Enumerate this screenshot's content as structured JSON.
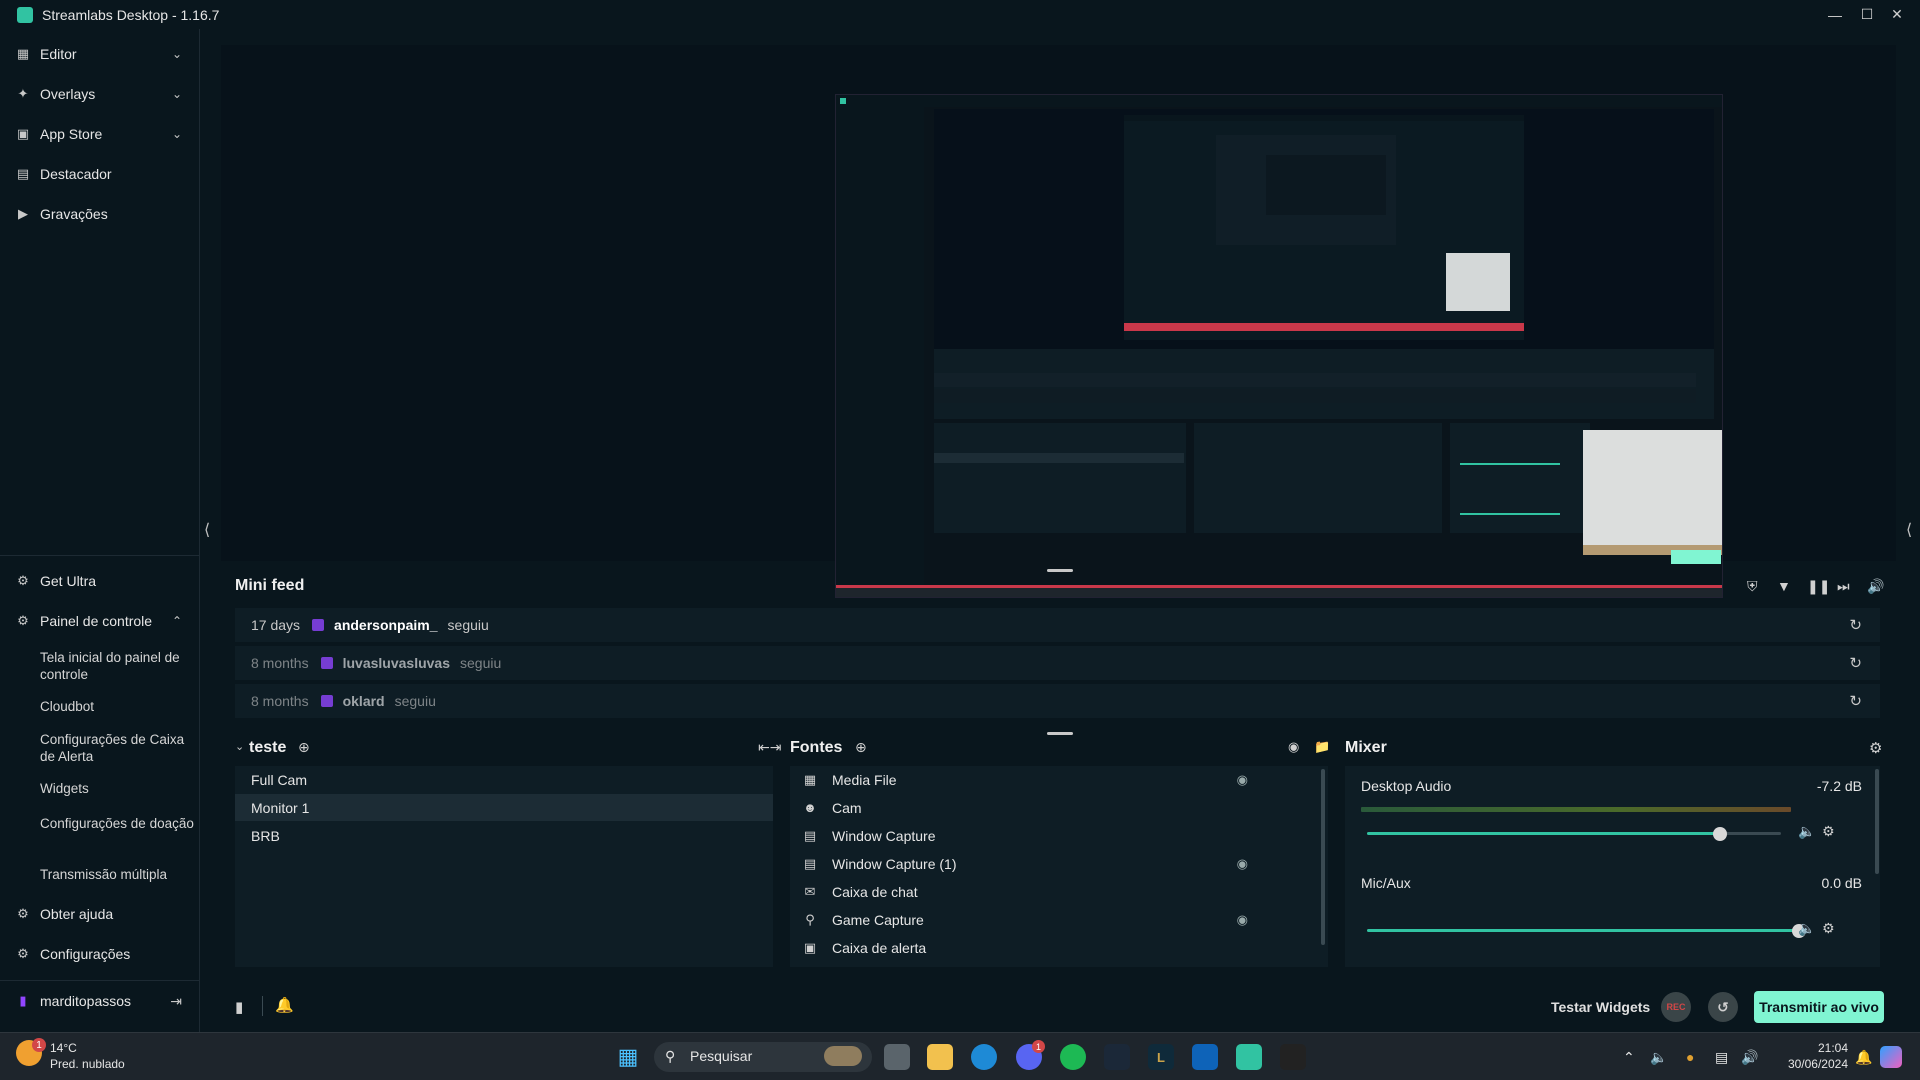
{
  "window": {
    "title": "Streamlabs Desktop - 1.16.7"
  },
  "sidebar": {
    "top_items": [
      {
        "label": "Editor",
        "icon": "editor-icon"
      },
      {
        "label": "Overlays",
        "icon": "overlays-icon"
      },
      {
        "label": "App Store",
        "icon": "app-store-icon"
      },
      {
        "label": "Destacador",
        "icon": "highlighter-icon"
      },
      {
        "label": "Gravações",
        "icon": "recordings-icon"
      }
    ],
    "get_ultra": "Get Ultra",
    "dashboard": "Painel de controle",
    "dashboard_sub": [
      "Tela inicial do painel de controle",
      "Cloudbot",
      "Configurações de Caixa de Alerta",
      "Widgets",
      "Configurações de doação",
      "Transmissão múltipla"
    ],
    "help": "Obter ajuda",
    "settings": "Configurações",
    "account": "marditopassos"
  },
  "minifeed": {
    "title": "Mini feed",
    "rows": [
      {
        "time": "17 days",
        "user": "andersonpaim_",
        "action": "seguiu"
      },
      {
        "time": "8 months",
        "user": "luvasluvasluvas",
        "action": "seguiu"
      },
      {
        "time": "8 months",
        "user": "oklard",
        "action": "seguiu"
      }
    ]
  },
  "scenes": {
    "title": "teste",
    "items": [
      "Full Cam",
      "Monitor 1",
      "BRB"
    ],
    "selected": "Monitor 1"
  },
  "sources": {
    "title": "Fontes",
    "items": [
      {
        "label": "Media File",
        "icon": "media-file-icon",
        "hidden": true
      },
      {
        "label": "Cam",
        "icon": "camera-icon",
        "hidden": false
      },
      {
        "label": "Window Capture",
        "icon": "window-icon",
        "hidden": false
      },
      {
        "label": "Window Capture (1)",
        "icon": "window-icon",
        "hidden": true
      },
      {
        "label": "Caixa de chat",
        "icon": "chat-icon",
        "hidden": false
      },
      {
        "label": "Game Capture",
        "icon": "gamepad-icon",
        "hidden": true
      },
      {
        "label": "Caixa de alerta",
        "icon": "alert-box-icon",
        "hidden": false
      }
    ]
  },
  "mixer": {
    "title": "Mixer",
    "channels": [
      {
        "name": "Desktop Audio",
        "db": "-7.2 dB",
        "level": 0.8
      },
      {
        "name": "Mic/Aux",
        "db": "0.0 dB",
        "level": 1.0
      }
    ]
  },
  "footer": {
    "test_widgets": "Testar Widgets",
    "rec": "REC",
    "go_live": "Transmitir ao vivo"
  },
  "taskbar": {
    "weather_temp": "14°C",
    "weather_desc": "Pred. nublado",
    "search_placeholder": "Pesquisar",
    "time": "21:04",
    "date": "30/06/2024",
    "discord_badge": "1",
    "weather_badge": "1"
  },
  "colors": {
    "accent": "#31c3a2",
    "go_live_bg": "#80f5d2",
    "background": "#09161d",
    "panel": "#0e1d25",
    "twitch": "#9146ff",
    "rec": "#d24747"
  }
}
